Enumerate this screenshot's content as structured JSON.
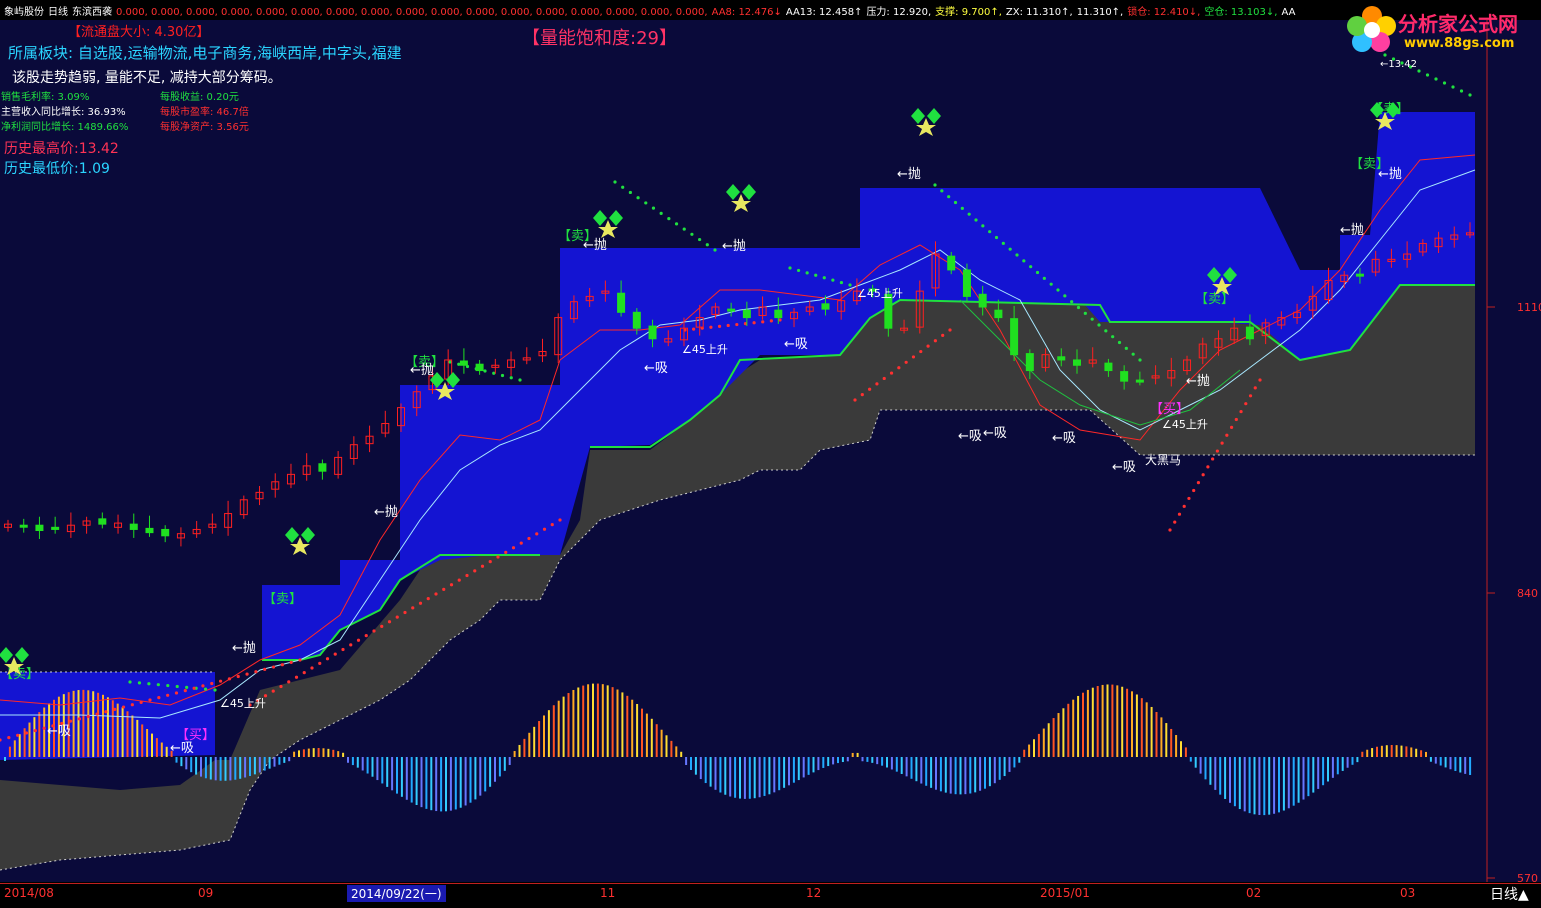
{
  "header": {
    "stock_name": "象屿股份",
    "period": "日线",
    "formula_name": "东滨西袭",
    "values_text": "0.000, 0.000, 0.000, 0.000, 0.000, 0.000, 0.000, 0.000, 0.000, 0.000, 0.000, 0.000, 0.000, 0.000, 0.000, 0.000, 0.000,",
    "aa8": "AA8: 12.476↓",
    "aa13": "AA13: 12.458↑",
    "pressure": "压力: 12.920,",
    "support": "支撑: 9.700↑,",
    "zx": "ZX: 11.310↑,",
    "zx2": "11.310↑,",
    "lock": "锁仓: 12.410↓,",
    "empty": "空仓: 13.103↓,",
    "aa": "AA"
  },
  "logo": {
    "main": "分析家公式网",
    "url": "www.88gs.com"
  },
  "info": {
    "float_cap": "【流通盘大小: 4.30亿】",
    "saturation": "【量能饱和度:29】",
    "sectors": "所属板块: 自选股,运输物流,电子商务,海峡西岸,中字头,福建",
    "comment": "该股走势趋弱, 量能不足, 减持大部分筹码。",
    "gross_margin": "销售毛利率: 3.09%",
    "eps": "每股收益: 0.20元",
    "revenue_growth": "主营收入同比增长: 36.93%",
    "pe": "每股市盈率: 46.7倍",
    "profit_growth": "净利润同比增长: 1489.66%",
    "bvps": "每股净资产: 3.56元",
    "hist_high": "历史最高价:13.42",
    "hist_low": "历史最低价:1.09"
  },
  "price_axis": {
    "labels": [
      "1110",
      "840",
      "570"
    ]
  },
  "x_axis": {
    "labels": [
      "2014/08",
      "09",
      "2014/09/22(一)",
      "11",
      "12",
      "2015/01",
      "02",
      "03"
    ],
    "period_label": "日线▲"
  },
  "annotations": {
    "sell": "【卖】",
    "buy": "【买】",
    "throw": "←抛",
    "absorb": "←吸",
    "rise45": "∠45上升",
    "big_black_horse": "大黑马",
    "peak": "←13.42"
  },
  "colors": {
    "background": "#0a0a3a",
    "band_fill": "#1414d2",
    "gray_fill": "#3a3a3a",
    "up_candle": "#ff2020",
    "down_candle": "#20e020",
    "green_line": "#20e040",
    "accent_text": "#ff3355",
    "cyan_text": "#2ad4ff"
  },
  "chart_data": {
    "type": "candlestick",
    "title": "",
    "y_axis_range": [
      540,
      1200
    ],
    "candles_note": "approximate daily closes (price axis units as printed)",
    "close": [
      905,
      903,
      899,
      900,
      904,
      908,
      905,
      906,
      900,
      897,
      894,
      896,
      900,
      905,
      915,
      928,
      935,
      945,
      952,
      960,
      955,
      968,
      980,
      988,
      1000,
      1015,
      1030,
      1045,
      1060,
      1055,
      1050,
      1055,
      1060,
      1062,
      1068,
      1100,
      1115,
      1120,
      1125,
      1105,
      1090,
      1080,
      1080,
      1090,
      1100,
      1110,
      1107,
      1100,
      1110,
      1100,
      1105,
      1110,
      1108,
      1116,
      1125,
      1125,
      1090,
      1090,
      1125,
      1160,
      1145,
      1120,
      1110,
      1100,
      1065,
      1050,
      1065,
      1060,
      1055,
      1060,
      1050,
      1040,
      1040,
      1045,
      1050,
      1060,
      1075,
      1080,
      1090,
      1080,
      1095,
      1100,
      1105,
      1120,
      1135,
      1140,
      1140,
      1155,
      1155,
      1160,
      1170,
      1175,
      1178,
      1180
    ]
  }
}
